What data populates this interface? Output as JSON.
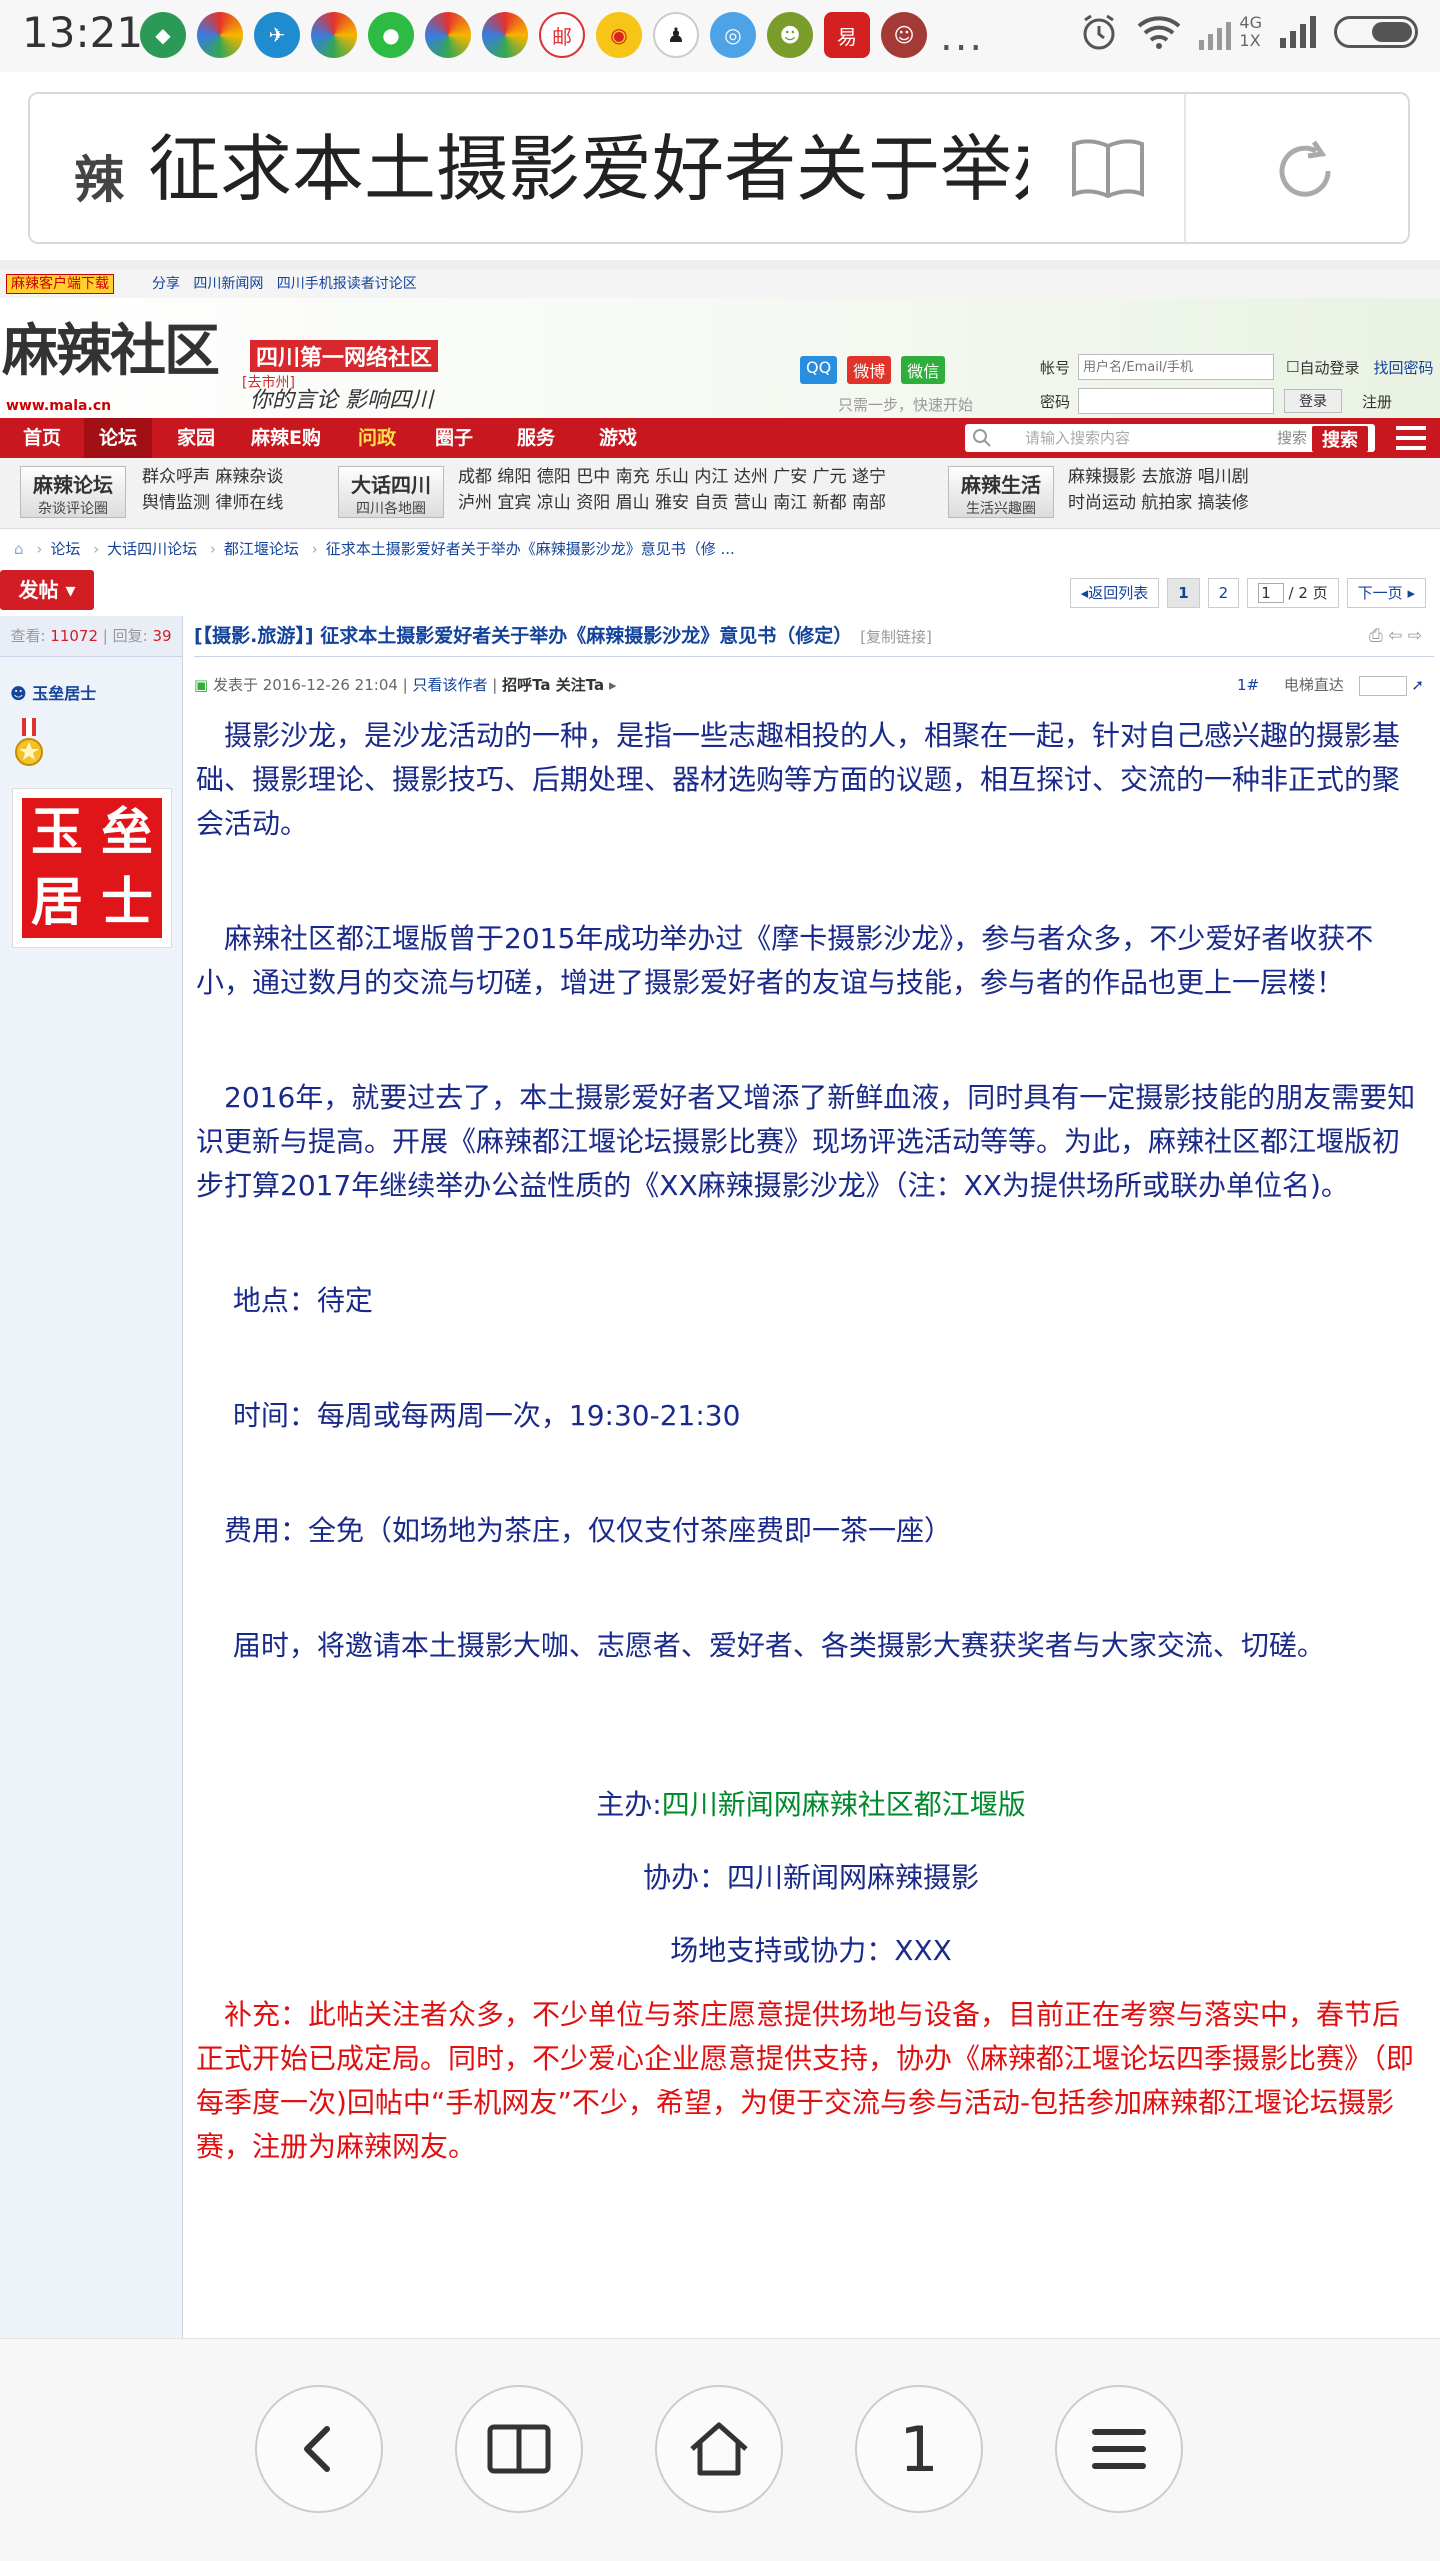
{
  "status_bar": {
    "time": "13:21",
    "app_icons": [
      "shield-icon",
      "browser-icon",
      "bird-icon",
      "browser-icon",
      "wechat-icon",
      "browser-icon",
      "browser-icon",
      "mail-icon",
      "weibo-icon",
      "qq-icon",
      "app-icon",
      "game-icon",
      "netease-icon",
      "avatar-icon"
    ],
    "more": "...",
    "network_top": "4G",
    "network_bottom": "1X"
  },
  "address_bar": {
    "title": "征求本土摄影爱好者关于举办《麻辣摄影沙龙》意见书"
  },
  "top_strip": {
    "badge": "麻辣客户端下载",
    "links": [
      "分享",
      "四川新闻网",
      "四川手机报读者讨论区"
    ]
  },
  "header": {
    "logo": "麻辣社区",
    "logo_sub": "www.mala.cn",
    "slogan_title": "四川第一网络社区",
    "slogan_city": "[去市州]",
    "slogan_script": "你的言论 影响四川",
    "social": [
      "QQ",
      "微博",
      "微信"
    ],
    "social_note": "只需一步，快速开始",
    "account_label": "帐号",
    "account_placeholder": "用户名/Email/手机",
    "auto_login": "自动登录",
    "recover": "找回密码",
    "password_label": "密码",
    "login": "登录",
    "register": "注册"
  },
  "nav": {
    "items": [
      "首页",
      "论坛",
      "家园",
      "麻辣E购",
      "问政",
      "圈子",
      "服务",
      "游戏"
    ],
    "search_placeholder": "请输入搜索内容",
    "search_hint": "搜索",
    "search_button": "搜索"
  },
  "subnav": {
    "groups": [
      {
        "title": "麻辣论坛",
        "sub": "杂谈评论圈",
        "links": [
          "群众呼声  麻辣杂谈",
          "舆情监测  律师在线"
        ]
      },
      {
        "title": "大话四川",
        "sub": "四川各地圈",
        "links": [
          "成都  绵阳  德阳  巴中  南充  乐山  内江  达州  广安  广元  遂宁",
          "泸州  宜宾  凉山  资阳  眉山  雅安  自贡  营山  南江  新都  南部"
        ]
      },
      {
        "title": "麻辣生活",
        "sub": "生活兴趣圈",
        "links": [
          "麻辣摄影  去旅游    唱川剧",
          "时尚运动  航拍家    搞装修"
        ]
      }
    ]
  },
  "breadcrumb": [
    "论坛",
    "大话四川论坛",
    "都江堰论坛",
    "征求本土摄影爱好者关于举办《麻辣摄影沙龙》意见书（修 ..."
  ],
  "toolbar": {
    "post_button": "发帖",
    "back": "返回列表",
    "page1": "1",
    "page2": "2",
    "page_input": "1",
    "page_total": "/ 2 页",
    "next": "下一页"
  },
  "thread": {
    "views_label": "查看:",
    "views": "11072",
    "replies_label": "回复:",
    "replies": "39",
    "title": "[【摄影.旅游】] 征求本土摄影爱好者关于举办《麻辣摄影沙龙》意见书（修定）",
    "copy_link": "[复制链接]",
    "author": "玉垒居士",
    "posted": "发表于 2016-12-26 21:04",
    "only_author": "只看该作者",
    "greet": "招呼Ta  关注Ta",
    "floor": "1#",
    "elevator": "电梯直达"
  },
  "post": {
    "p1": "　摄影沙龙，是沙龙活动的一种，是指一些志趣相投的人，相聚在一起，针对自己感兴趣的摄影基础、摄影理论、摄影技巧、后期处理、器材选购等方面的议题，相互探讨、交流的一种非正式的聚会活动。",
    "p2": "　麻辣社区都江堰版曾于2015年成功举办过《摩卡摄影沙龙》，参与者众多，不少爱好者收获不小，通过数月的交流与切磋，增进了摄影爱好者的友谊与技能，参与者的作品也更上一层楼！",
    "p3": "　2016年，就要过去了，本土摄影爱好者又增添了新鲜血液，同时具有一定摄影技能的朋友需要知识更新与提高。开展《麻辣都江堰论坛摄影比赛》现场评选活动等等。为此，麻辣社区都江堰版初步打算2017年继续举办公益性质的《XX麻辣摄影沙龙》（注：XX为提供场所或联办单位名)。",
    "place": "　 地点：待定",
    "time": "　 时间：每周或每两周一次，19:30-21:30",
    "fee": "　费用：全免（如场地为茶庄，仅仅支付茶座费即一茶一座）",
    "invite": "　 届时，将邀请本土摄影大咖、志愿者、爱好者、各类摄影大赛获奖者与大家交流、切磋。",
    "host_label": "主办:",
    "host": "四川新闻网麻辣社区都江堰版",
    "co": "协办：四川新闻网麻辣摄影",
    "venue": "场地支持或协力：XXX",
    "note": "　补充：此帖关注者众多，不少单位与茶庄愿意提供场地与设备，目前正在考察与落实中，春节后正式开始已成定局。同时，不少爱心企业愿意提供支持，协办《麻辣都江堰论坛四季摄影比赛》（即每季度一次)回帖中“手机网友”不少，希望，为便于交流与参与活动-包括参加麻辣都江堰论坛摄影赛，注册为麻辣网友。"
  },
  "bottom_nav": {
    "tab_count": "1",
    "icons": [
      "back-icon",
      "reader-icon",
      "home-icon",
      "tabs-icon",
      "menu-icon"
    ]
  },
  "colors": {
    "brand_red": "#c9171f",
    "link_blue": "#14439c",
    "body_text": "#1a2a8a",
    "note_red": "#e01010",
    "host_green": "#008a2b"
  }
}
